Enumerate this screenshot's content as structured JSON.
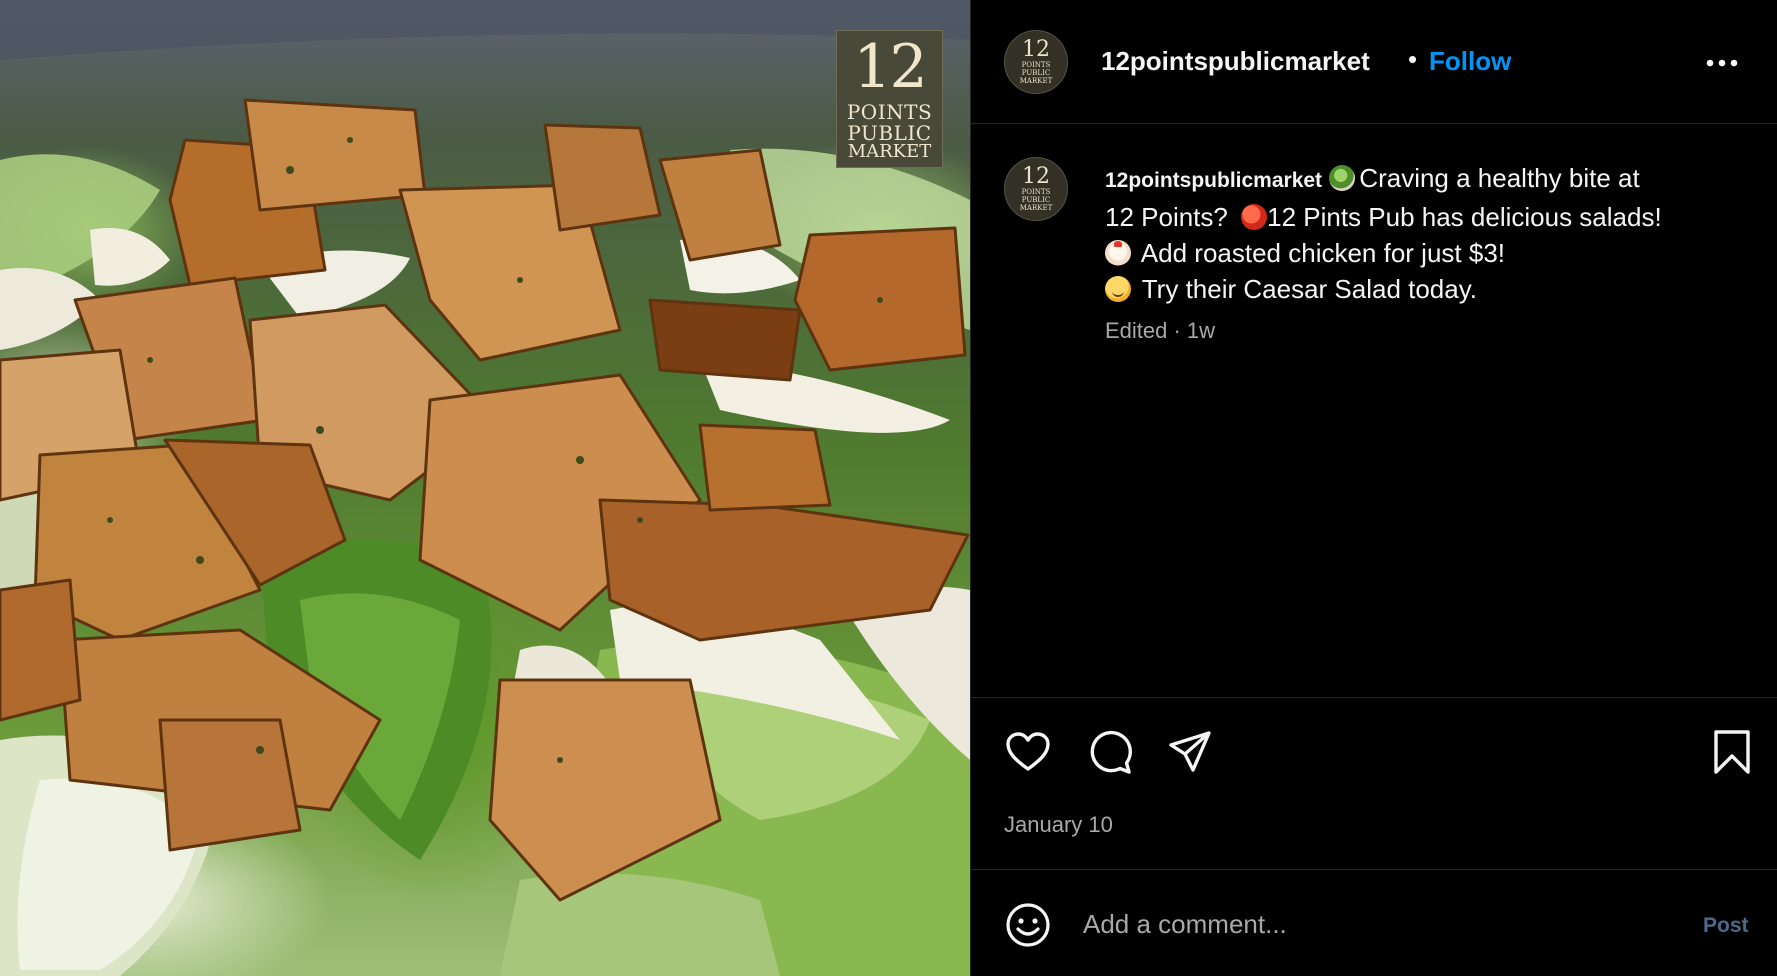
{
  "photo": {
    "logo_text": [
      "12",
      "POINTS",
      "PUBLIC",
      "MARKET"
    ]
  },
  "header": {
    "username": "12pointspublicmarket",
    "separator": "•",
    "follow_label": "Follow"
  },
  "caption": {
    "username": "12pointspublicmarket",
    "lines": [
      "Craving a healthy bite at",
      "12 Points?",
      "12 Pints Pub has delicious salads!",
      "Add roasted chicken for just $3!",
      "Try their Caesar Salad today."
    ],
    "meta": "Edited · 1w"
  },
  "actions": {
    "icons": [
      "heart-icon",
      "comment-icon",
      "share-icon",
      "bookmark-icon"
    ],
    "date": "January 10"
  },
  "comment": {
    "placeholder": "Add a comment...",
    "post_label": "Post"
  },
  "colors": {
    "accent": "#0095f6",
    "post_disabled": "#4c6a8a",
    "muted_text": "#a8a8a8",
    "background": "#000000"
  }
}
